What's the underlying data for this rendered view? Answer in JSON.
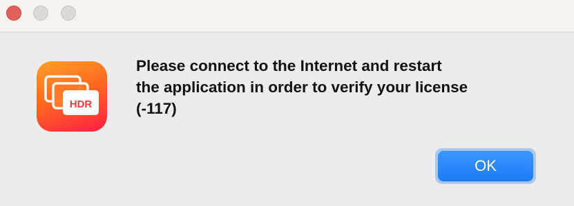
{
  "window": {
    "controls": [
      "close",
      "minimize",
      "zoom"
    ]
  },
  "dialog": {
    "icon": {
      "name": "hdr-app-icon",
      "badge_text": "HDR"
    },
    "message": "Please connect to the Internet and restart\nthe application in order to verify your license\n(-117)",
    "ok_label": "OK"
  },
  "colors": {
    "accent": "#1a7cf5",
    "close_button": "#e0605a"
  }
}
